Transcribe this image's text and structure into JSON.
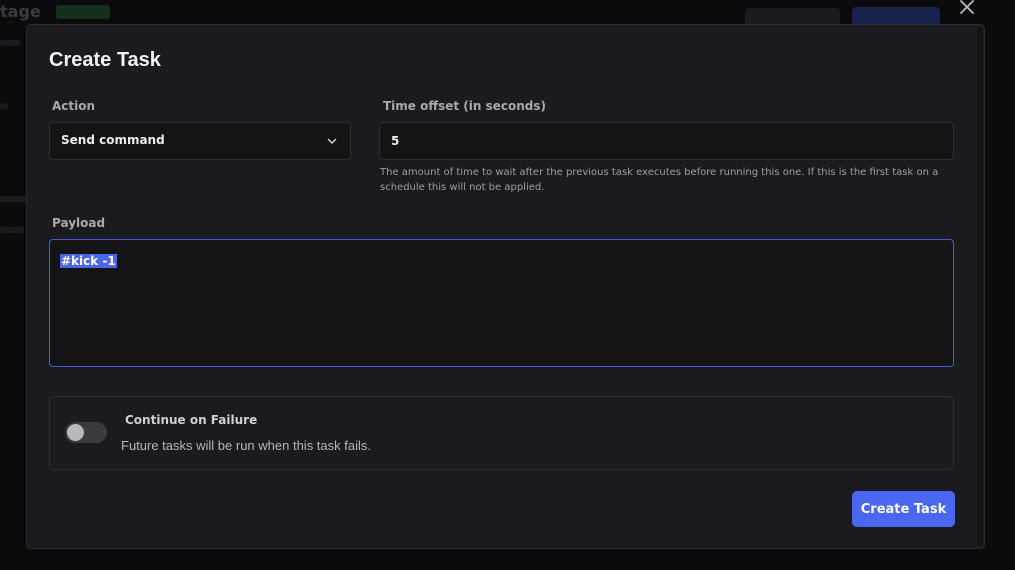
{
  "background": {
    "app_title": "tage"
  },
  "modal": {
    "title": "Create Task",
    "close_icon": "close-icon",
    "action": {
      "label": "Action",
      "selected": "Send command",
      "icon": "chevron-down-icon"
    },
    "time_offset": {
      "label": "Time offset (in seconds)",
      "value": "5",
      "help": "The amount of time to wait after the previous task executes before running this one. If this is the first task on a schedule this will not be applied."
    },
    "payload": {
      "label": "Payload",
      "value": "#kick -1"
    },
    "continue_on_failure": {
      "title": "Continue on Failure",
      "description": "Future tasks will be run when this task fails.",
      "enabled": false
    },
    "submit_label": "Create Task"
  },
  "colors": {
    "accent": "#4a67f0",
    "focus_border": "#4a5ad6",
    "modal_bg": "#1b1b1f",
    "field_bg": "#141417"
  }
}
